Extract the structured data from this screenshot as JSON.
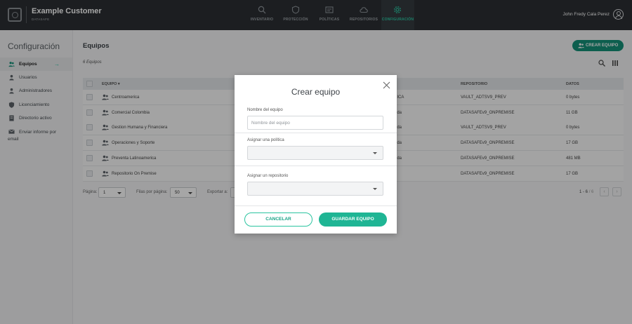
{
  "header": {
    "brand_name": "Example Customer",
    "brand_sub": "DATASAFE",
    "user_name": "John Fredy Cala Perez",
    "nav": [
      {
        "label": "INVENTARIO",
        "icon": "search-icon"
      },
      {
        "label": "PROTECCIÓN",
        "icon": "shield-icon"
      },
      {
        "label": "POLÍTICAS",
        "icon": "policy-icon"
      },
      {
        "label": "REPOSITORIOS",
        "icon": "cloud-icon"
      },
      {
        "label": "CONFIGURACIÓN",
        "icon": "gear-icon",
        "active": true
      }
    ]
  },
  "sidebar": {
    "title": "Configuración",
    "items": [
      {
        "label": "Equipos",
        "icon": "team-icon",
        "active": true
      },
      {
        "label": "Usuarios",
        "icon": "user-icon"
      },
      {
        "label": "Administradores",
        "icon": "admin-icon"
      },
      {
        "label": "Licenciamiento",
        "icon": "license-icon"
      },
      {
        "label": "Directorio activo",
        "icon": "directory-icon"
      },
      {
        "label": "Enviar informe por email",
        "icon": "mail-icon"
      }
    ]
  },
  "main": {
    "title": "Equipos",
    "count_text": "6 Equipos",
    "create_button": "CREAR EQUIPO",
    "table": {
      "headers": {
        "team": "EQUIPO",
        "repo": "REPOSITORIO",
        "data": "DATOS"
      },
      "rows": [
        {
          "name": "Centroamerica",
          "owner": "AMERICA",
          "repo": "VAULT_ADTSV9_PREV",
          "data": "0 bytes"
        },
        {
          "name": "Comercial Colombia",
          "owner": "a Aranda",
          "repo": "DATASAFEv9_ONPREMISE",
          "data": "11 GB"
        },
        {
          "name": "Gestion Humana y Financiera",
          "owner": "a Aranda",
          "repo": "VAULT_ADTSV9_PREV",
          "data": "0 bytes"
        },
        {
          "name": "Operaciones y Soporte",
          "owner": "a Aranda",
          "repo": "DATASAFEv9_ONPREMISE",
          "data": "17 GB"
        },
        {
          "name": "Preventa Latinoamerica",
          "owner": "a Aranda",
          "repo": "DATASAFEv9_ONPREMISE",
          "data": "481 MB"
        },
        {
          "name": "Repositorio On Premise",
          "owner": "",
          "repo": "DATASAFEv9_ONPREMISE",
          "data": "17 GB"
        }
      ]
    },
    "pager": {
      "page_label": "Página:",
      "page_value": "1",
      "rows_label": "Filas por página:",
      "rows_value": "50",
      "export_label": "Exportar a:",
      "range": "1 - 6",
      "total": "/ 6"
    }
  },
  "modal": {
    "title": "Crear equipo",
    "name_label": "Nombre del equipo",
    "name_placeholder": "Nombre del equipo",
    "policy_label": "Asignar una política",
    "repo_label": "Asignar un repositorio",
    "cancel_label": "CANCELAR",
    "save_label": "GUARDAR EQUIPO"
  },
  "colors": {
    "accent": "#2bc4a0",
    "topbar": "#2b2f33",
    "create_button": "#159179"
  }
}
